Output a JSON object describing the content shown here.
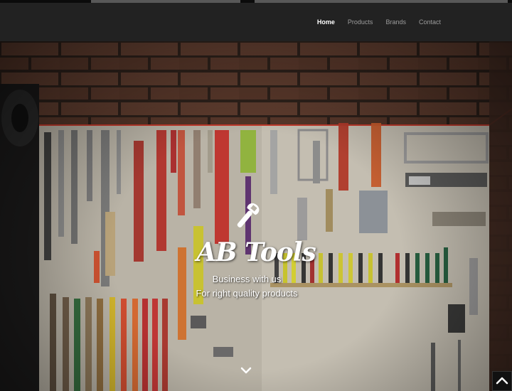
{
  "nav": {
    "items": [
      {
        "label": "Home",
        "active": true
      },
      {
        "label": "Products",
        "active": false
      },
      {
        "label": "Brands",
        "active": false
      },
      {
        "label": "Contact",
        "active": false
      }
    ]
  },
  "hero": {
    "logo_icon": "wrench-icon",
    "brand": "AB Tools",
    "tagline_1": "Business with us",
    "tagline_2": "For right quality products",
    "scroll_icon": "chevron-down-icon"
  },
  "back_to_top": {
    "icon": "chevron-up-icon"
  },
  "colors": {
    "navbar": "#222222",
    "nav_text": "#9d9d9d",
    "nav_active": "#ffffff"
  }
}
